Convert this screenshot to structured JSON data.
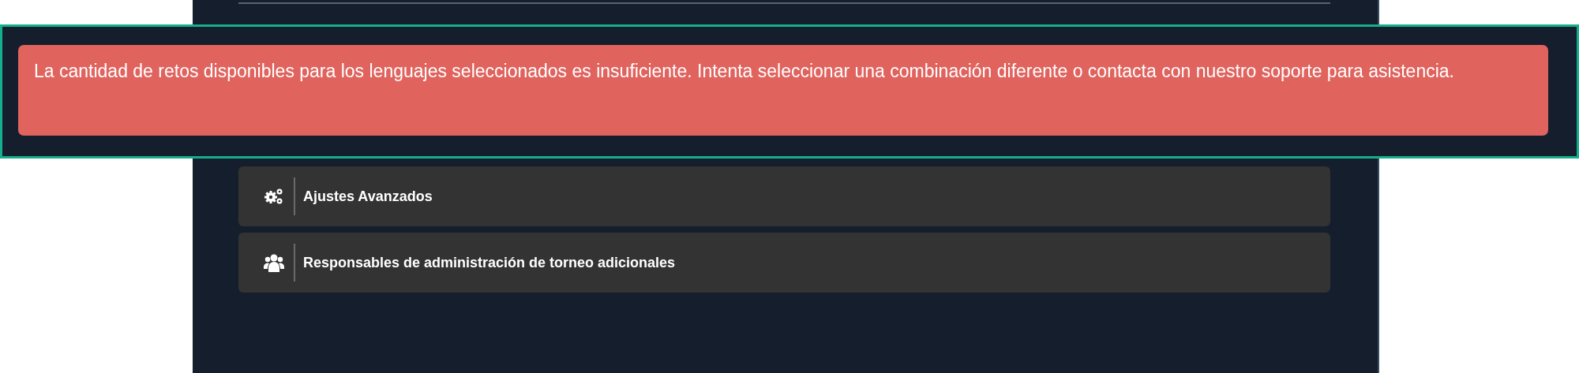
{
  "alert": {
    "message": "La cantidad de retos disponibles para los lenguajes seleccionados es insuficiente. Intenta seleccionar una combinación diferente o contacta con nuestro soporte para asistencia."
  },
  "sections": [
    {
      "kind": "settings",
      "label": "Ajustes Avanzados"
    },
    {
      "kind": "users",
      "label": "Responsables de administración de torneo adicionales"
    }
  ]
}
